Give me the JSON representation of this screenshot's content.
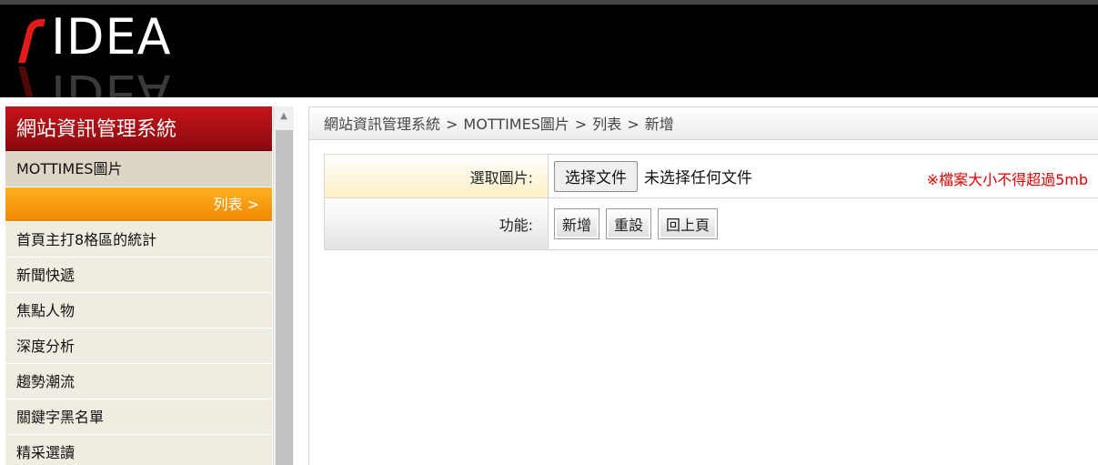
{
  "header": {
    "logo_text": "IDEA"
  },
  "sidebar": {
    "title": "網站資訊管理系統",
    "section": "MOTTIMES圖片",
    "sub_active": "列表 >",
    "items": [
      "首頁主打8格區的統計",
      "新聞快遞",
      "焦點人物",
      "深度分析",
      "趨勢潮流",
      "關鍵字黑名單",
      "精采選讀"
    ]
  },
  "breadcrumb": {
    "items": [
      "網站資訊管理系統",
      "MOTTIMES圖片",
      "列表",
      "新增"
    ],
    "separator": ">"
  },
  "form": {
    "file_label": "選取圖片:",
    "file_button": "选择文件",
    "file_status": "未选择任何文件",
    "note": "※檔案大小不得超過5mb",
    "actions_label": "功能:",
    "buttons": {
      "add": "新增",
      "reset": "重設",
      "back": "回上頁"
    }
  },
  "colors": {
    "accent_red": "#c4141a",
    "accent_orange": "#f7a000",
    "note_red": "#e00000"
  }
}
